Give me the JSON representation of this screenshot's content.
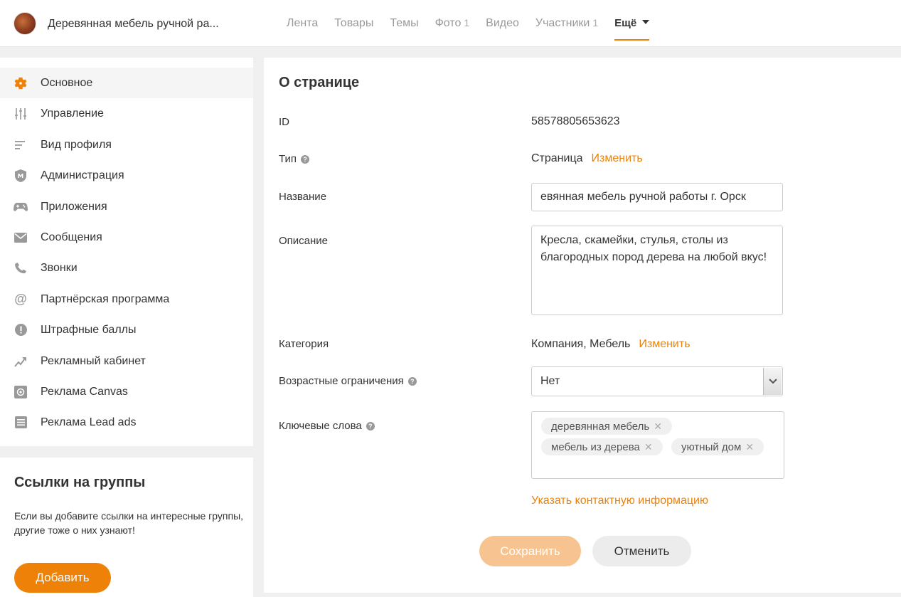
{
  "header": {
    "group_title": "Деревянная мебель ручной ра...",
    "nav": [
      {
        "label": "Лента",
        "count": ""
      },
      {
        "label": "Товары",
        "count": ""
      },
      {
        "label": "Темы",
        "count": ""
      },
      {
        "label": "Фото",
        "count": "1"
      },
      {
        "label": "Видео",
        "count": ""
      },
      {
        "label": "Участники",
        "count": "1"
      }
    ],
    "more_label": "Ещё"
  },
  "sidebar": {
    "items": [
      {
        "label": "Основное",
        "icon": "gear-icon"
      },
      {
        "label": "Управление",
        "icon": "sliders-icon"
      },
      {
        "label": "Вид профиля",
        "icon": "lines-icon"
      },
      {
        "label": "Администрация",
        "icon": "shield-icon"
      },
      {
        "label": "Приложения",
        "icon": "gamepad-icon"
      },
      {
        "label": "Сообщения",
        "icon": "envelope-icon"
      },
      {
        "label": "Звонки",
        "icon": "phone-icon"
      },
      {
        "label": "Партнёрская программа",
        "icon": "at-icon"
      },
      {
        "label": "Штрафные баллы",
        "icon": "exclamation-icon"
      },
      {
        "label": "Рекламный кабинет",
        "icon": "chart-arrow-icon"
      },
      {
        "label": "Реклама Canvas",
        "icon": "canvas-icon"
      },
      {
        "label": "Реклама Lead ads",
        "icon": "list-box-icon"
      }
    ]
  },
  "links_card": {
    "title": "Ссылки на группы",
    "text": "Если вы добавите ссылки на интересные группы, другие тоже о них узнают!",
    "add_label": "Добавить"
  },
  "main": {
    "title": "О странице",
    "id_label": "ID",
    "id_value": "58578805653623",
    "type_label": "Тип",
    "type_value": "Страница",
    "change_label": "Изменить",
    "name_label": "Название",
    "name_value": "евянная мебель ручной работы г. Орск",
    "desc_label": "Описание",
    "desc_value": "Кресла, скамейки, стулья, столы из благородных пород дерева на любой вкус!",
    "category_label": "Категория",
    "category_value": "Компания, Мебель",
    "age_label": "Возрастные ограничения",
    "age_value": "Нет",
    "keywords_label": "Ключевые слова",
    "keywords": [
      "деревянная мебель",
      "мебель из дерева",
      "уютный дом"
    ],
    "contact_link": "Указать контактную информацию",
    "save_label": "Сохранить",
    "cancel_label": "Отменить"
  },
  "colors": {
    "accent": "#ee8208",
    "accent_disabled": "#f7c491"
  }
}
